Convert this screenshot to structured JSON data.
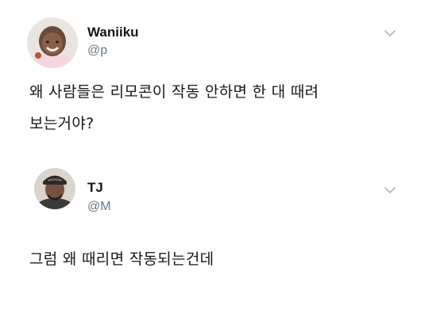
{
  "tweets": [
    {
      "display_name": "Waniiku",
      "handle": "@p",
      "text_lines": [
        "왜 사람들은 리모콘이 작동 안하면 한 대 때려",
        "보는거야?"
      ],
      "menu_icon": "chevron-down-icon",
      "avatar": "avatar-child-smiling"
    },
    {
      "display_name": "TJ",
      "handle": "@M",
      "text_lines": [
        "그럼 왜 때리면 작동되는건데"
      ],
      "menu_icon": "chevron-down-icon",
      "avatar": "avatar-man-cap"
    }
  ],
  "colors": {
    "text_primary": "#14171a",
    "text_secondary": "#657786",
    "icon": "#aab8c2",
    "background": "#ffffff"
  }
}
